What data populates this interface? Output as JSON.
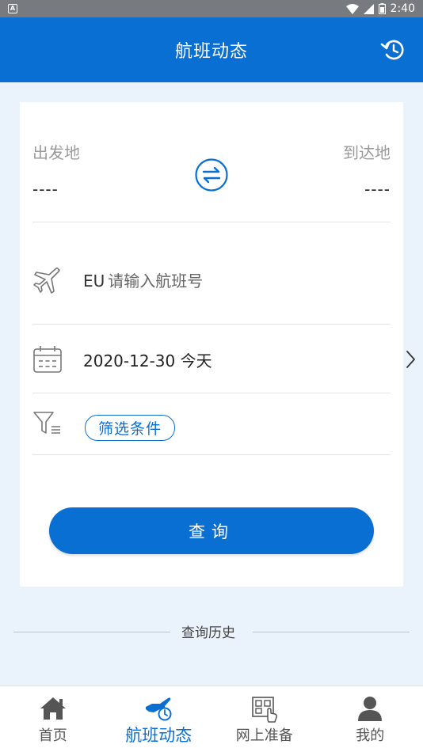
{
  "status_bar": {
    "notification_icon": "A",
    "time": "2:40",
    "icons": [
      "wifi-icon",
      "signal-icon",
      "battery-icon"
    ]
  },
  "header": {
    "title": "航班动态",
    "refresh_icon": "refresh-icon"
  },
  "route": {
    "from_label": "出发地",
    "from_value": "----",
    "to_label": "到达地",
    "to_value": "----",
    "swap_icon": "swap-icon"
  },
  "flight": {
    "prefix": "EU",
    "placeholder": "请输入航班号",
    "icon": "airplane-icon"
  },
  "date": {
    "value": "2020-12-30 今天",
    "icon": "calendar-icon"
  },
  "filter": {
    "label": "筛选条件",
    "icon": "filter-icon"
  },
  "query_button": "查询",
  "history_label": "查询历史",
  "tabs": [
    {
      "label": "首页",
      "icon": "home-icon",
      "active": false
    },
    {
      "label": "航班动态",
      "icon": "flight-status-icon",
      "active": true
    },
    {
      "label": "网上准备",
      "icon": "online-prep-icon",
      "active": false
    },
    {
      "label": "我的",
      "icon": "user-icon",
      "active": false
    }
  ],
  "colors": {
    "primary": "#0a6fd3",
    "background": "#eaf2fb",
    "status_bar": "#777a7e"
  }
}
